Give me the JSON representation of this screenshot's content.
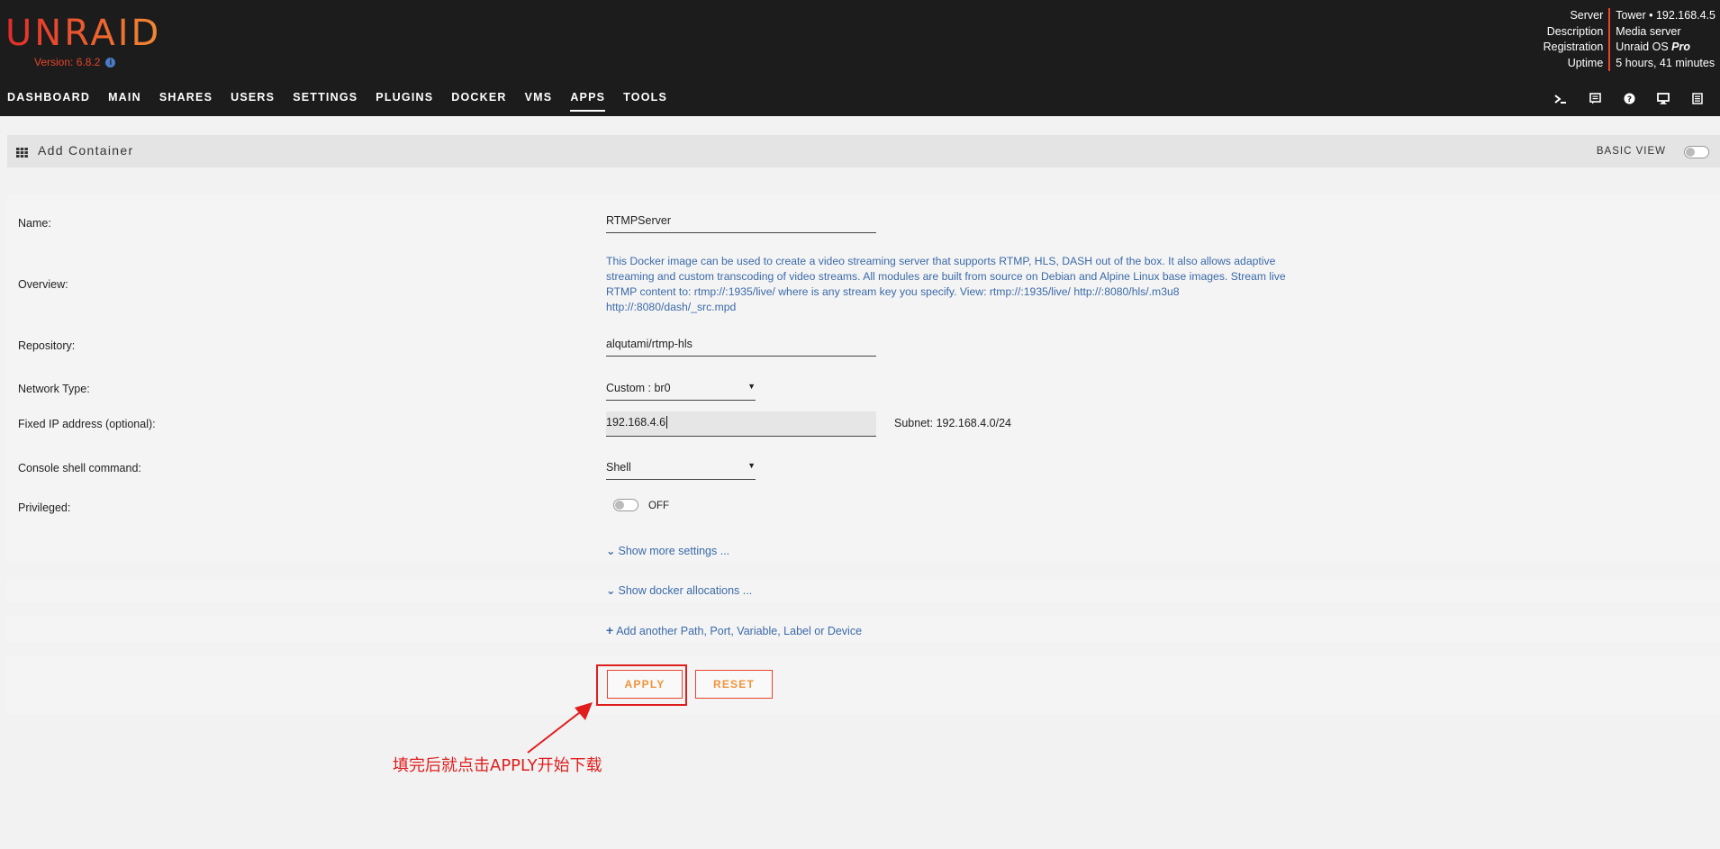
{
  "app": {
    "logo": "UNRAID",
    "version": "Version: 6.8.2"
  },
  "server_info": {
    "labels": [
      "Server",
      "Description",
      "Registration",
      "Uptime"
    ],
    "server": "Tower • 192.168.4.5",
    "description": "Media server",
    "registration_prefix": "Unraid OS ",
    "registration_tier": "Pro",
    "uptime": "5 hours, 41 minutes"
  },
  "nav": {
    "items": [
      "DASHBOARD",
      "MAIN",
      "SHARES",
      "USERS",
      "SETTINGS",
      "PLUGINS",
      "DOCKER",
      "VMS",
      "APPS",
      "TOOLS"
    ],
    "active": "APPS",
    "icons": [
      "terminal-icon",
      "feedback-icon",
      "help-icon",
      "monitor-icon",
      "log-icon"
    ]
  },
  "page": {
    "title": "Add Container",
    "basic_view_label": "BASIC VIEW",
    "basic_view_on": false
  },
  "form": {
    "name_label": "Name:",
    "name_value": "RTMPServer",
    "overview_label": "Overview:",
    "overview_text": "This Docker image can be used to create a video streaming server that supports RTMP, HLS, DASH out of the box. It also allows adaptive streaming and custom transcoding of video streams. All modules are built from source on Debian and Alpine Linux base images. Stream live RTMP content to: rtmp://:1935/live/ where is any stream key you specify. View: rtmp://:1935/live/ http://:8080/hls/.m3u8 http://:8080/dash/_src.mpd",
    "repository_label": "Repository:",
    "repository_value": "alqutami/rtmp-hls",
    "network_label": "Network Type:",
    "network_value": "Custom : br0",
    "fixed_ip_label": "Fixed IP address (optional):",
    "fixed_ip_value": "192.168.4.6",
    "subnet_text": "Subnet: 192.168.4.0/24",
    "console_label": "Console shell command:",
    "console_value": "Shell",
    "privileged_label": "Privileged:",
    "privileged_state": "OFF",
    "show_more": "Show more settings ..."
  },
  "allocations": {
    "show_docker": "Show docker allocations ..."
  },
  "add_more": {
    "label": "Add another Path, Port, Variable, Label or Device"
  },
  "buttons": {
    "apply": "APPLY",
    "reset": "RESET"
  },
  "annotation": {
    "text": "填完后就点击APPLY开始下载",
    "color": "#e01e1e"
  },
  "colors": {
    "accent": "#e8432a",
    "link": "#3b6aa8",
    "header_bg": "#1c1c1c"
  }
}
